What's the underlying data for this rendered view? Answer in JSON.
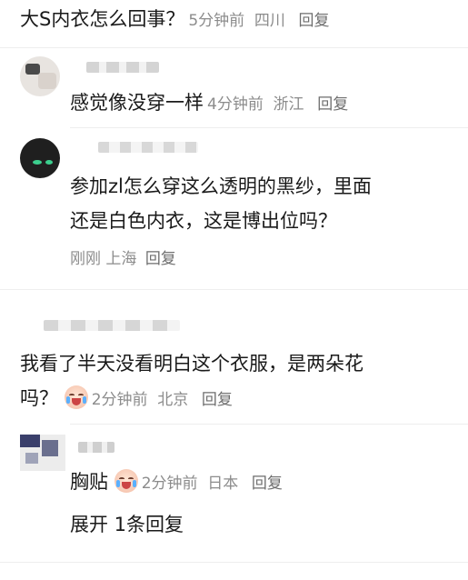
{
  "comments": [
    {
      "text": "大S内衣怎么回事？",
      "time": "5分钟前",
      "location": "四川",
      "reply_label": "回复"
    },
    {
      "text": "感觉像没穿一样",
      "time": "4分钟前",
      "location": "浙江",
      "reply_label": "回复"
    },
    {
      "text_line1": "参加zl怎么穿这么透明的黑纱，里面",
      "text_line2": "还是白色内衣，这是博出位吗？",
      "time": "刚刚",
      "location": "上海",
      "reply_label": "回复"
    },
    {
      "text_line1": "我看了半天没看明白这个衣服，是两朵花",
      "text_line2": "吗？",
      "emoji": "crying-laughing-emoji",
      "time": "2分钟前",
      "location": "北京",
      "reply_label": "回复"
    },
    {
      "text": "胸贴",
      "emoji": "crying-laughing-emoji",
      "time": "2分钟前",
      "location": "日本",
      "reply_label": "回复"
    }
  ],
  "expand_replies": "展开 1条回复"
}
